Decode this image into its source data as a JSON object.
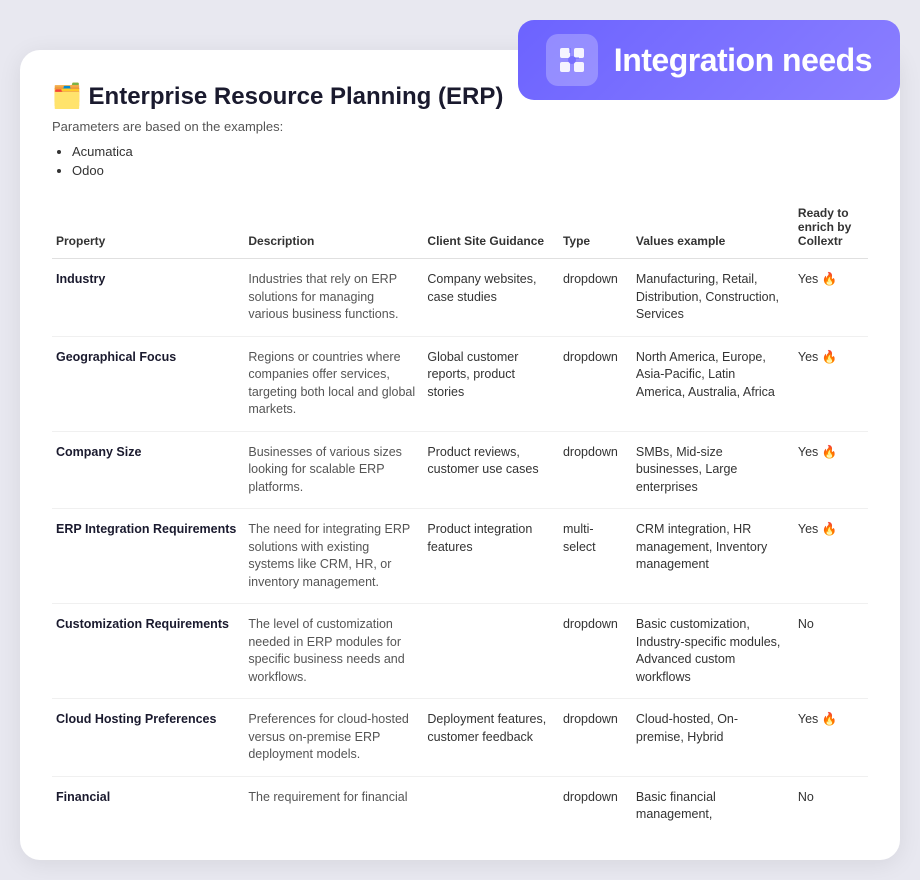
{
  "header": {
    "title": "Integration needs",
    "icon_label": "integration-icon"
  },
  "section": {
    "title": "🗂️ Enterprise Resource Planning (ERP)",
    "subtitle": "Parameters are based on the examples:",
    "examples": [
      "Acumatica",
      "Odoo"
    ]
  },
  "table": {
    "columns": [
      {
        "id": "property",
        "label": "Property"
      },
      {
        "id": "description",
        "label": "Description"
      },
      {
        "id": "guidance",
        "label": "Client Site Guidance"
      },
      {
        "id": "type",
        "label": "Type"
      },
      {
        "id": "values",
        "label": "Values example"
      },
      {
        "id": "ready",
        "label": "Ready to enrich by Collextr"
      }
    ],
    "rows": [
      {
        "property": "Industry",
        "description": "Industries that rely on ERP solutions for managing various business functions.",
        "guidance": "Company websites, case studies",
        "type": "dropdown",
        "values": "Manufacturing, Retail, Distribution, Construction, Services",
        "ready": "Yes 🔥"
      },
      {
        "property": "Geographical Focus",
        "description": "Regions or countries where companies offer services, targeting both local and global markets.",
        "guidance": "Global customer reports, product stories",
        "type": "dropdown",
        "values": "North America, Europe, Asia-Pacific, Latin America, Australia, Africa",
        "ready": "Yes 🔥"
      },
      {
        "property": "Company Size",
        "description": "Businesses of various sizes looking for scalable ERP platforms.",
        "guidance": "Product reviews, customer use cases",
        "type": "dropdown",
        "values": "SMBs, Mid-size businesses, Large enterprises",
        "ready": "Yes 🔥"
      },
      {
        "property": "ERP Integration Requirements",
        "description": "The need for integrating ERP solutions with existing systems like CRM, HR, or inventory management.",
        "guidance": "Product integration features",
        "type": "multi-select",
        "values": "CRM integration, HR management, Inventory management",
        "ready": "Yes 🔥"
      },
      {
        "property": "Customization Requirements",
        "description": "The level of customization needed in ERP modules for specific business needs and workflows.",
        "guidance": "",
        "type": "dropdown",
        "values": "Basic customization, Industry-specific modules, Advanced custom workflows",
        "ready": "No"
      },
      {
        "property": "Cloud Hosting Preferences",
        "description": "Preferences for cloud-hosted versus on-premise ERP deployment models.",
        "guidance": "Deployment features, customer feedback",
        "type": "dropdown",
        "values": "Cloud-hosted, On-premise, Hybrid",
        "ready": "Yes 🔥"
      },
      {
        "property": "Financial",
        "description": "The requirement for financial",
        "guidance": "",
        "type": "dropdown",
        "values": "Basic financial management,",
        "ready": "No"
      }
    ]
  }
}
